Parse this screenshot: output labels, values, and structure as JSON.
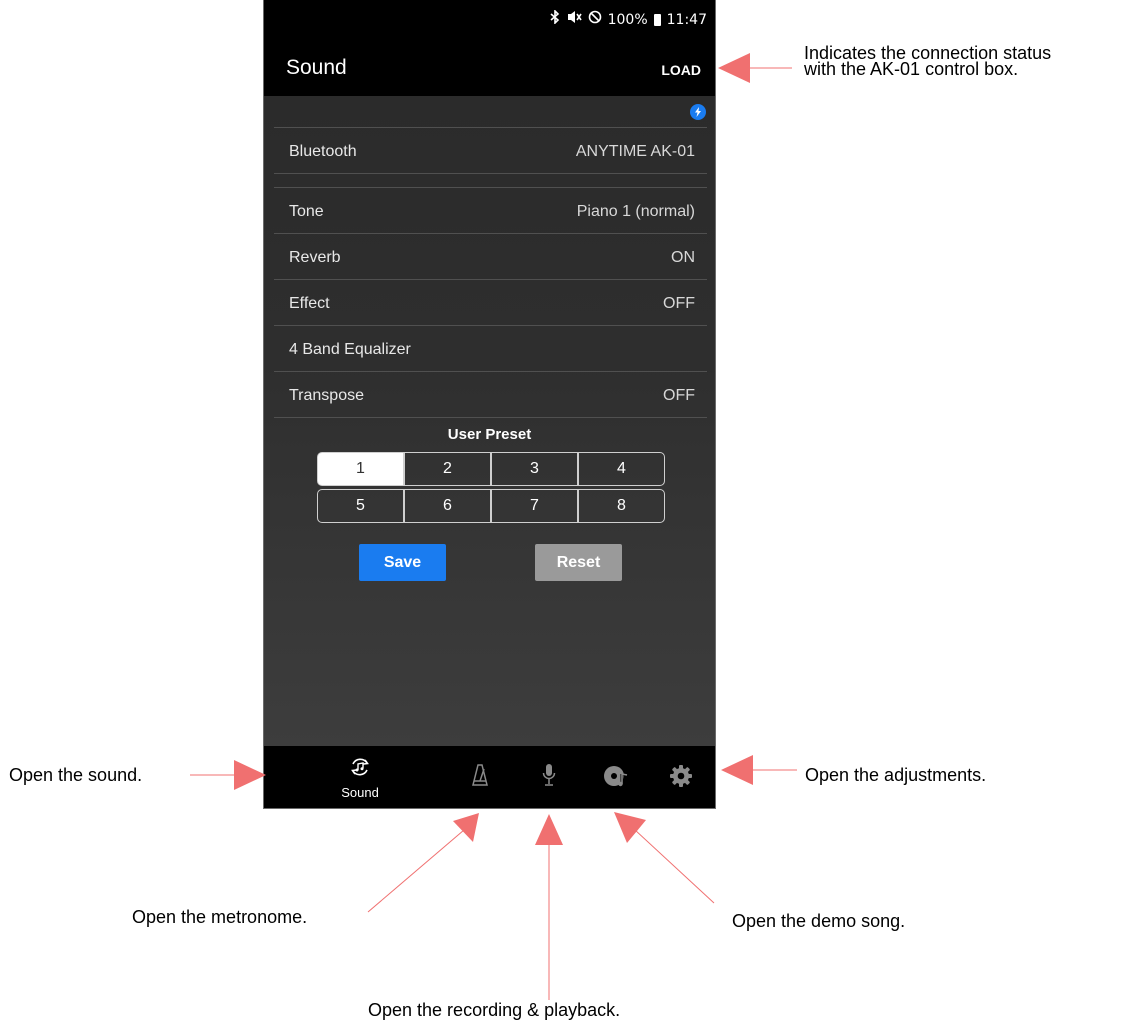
{
  "status_bar": {
    "bluetooth_icon": "bluetooth-icon",
    "mute_icon": "vibrate-mute-icon",
    "dnd_icon": "do-not-disturb-icon",
    "battery": "100%",
    "time": "11:47"
  },
  "app_bar": {
    "title": "Sound",
    "action": "LOAD"
  },
  "connection_indicator": {
    "icon": "connection-status-icon",
    "color": "#1a7cf0"
  },
  "settings": [
    {
      "label": "Bluetooth",
      "value": "ANYTIME AK-01"
    },
    {
      "label": "Tone",
      "value": "Piano 1 (normal)"
    },
    {
      "label": "Reverb",
      "value": "ON"
    },
    {
      "label": "Effect",
      "value": "OFF"
    },
    {
      "label": "4 Band Equalizer",
      "value": ""
    },
    {
      "label": "Transpose",
      "value": "OFF"
    }
  ],
  "user_preset": {
    "title": "User Preset",
    "buttons": [
      "1",
      "2",
      "3",
      "4",
      "5",
      "6",
      "7",
      "8"
    ],
    "selected": "1"
  },
  "actions": {
    "save": "Save",
    "reset": "Reset",
    "save_color": "#1a7cf0",
    "reset_color": "#9a9a9a"
  },
  "bottom_nav": [
    {
      "icon": "sound-icon",
      "label": "Sound",
      "active": true
    },
    {
      "icon": "metronome-icon",
      "label": "",
      "active": false
    },
    {
      "icon": "microphone-icon",
      "label": "",
      "active": false
    },
    {
      "icon": "demo-disc-icon",
      "label": "",
      "active": false
    },
    {
      "icon": "gear-icon",
      "label": "",
      "active": false
    }
  ],
  "annotations": {
    "connection_line1": "Indicates the connection status",
    "connection_line2": "with the AK-01 control box.",
    "sound": "Open the sound.",
    "adjustments": "Open the adjustments.",
    "metronome": "Open the metronome.",
    "demo_song": "Open the demo song.",
    "recording": "Open the recording & playback.",
    "arrow_color": "#f07070"
  }
}
